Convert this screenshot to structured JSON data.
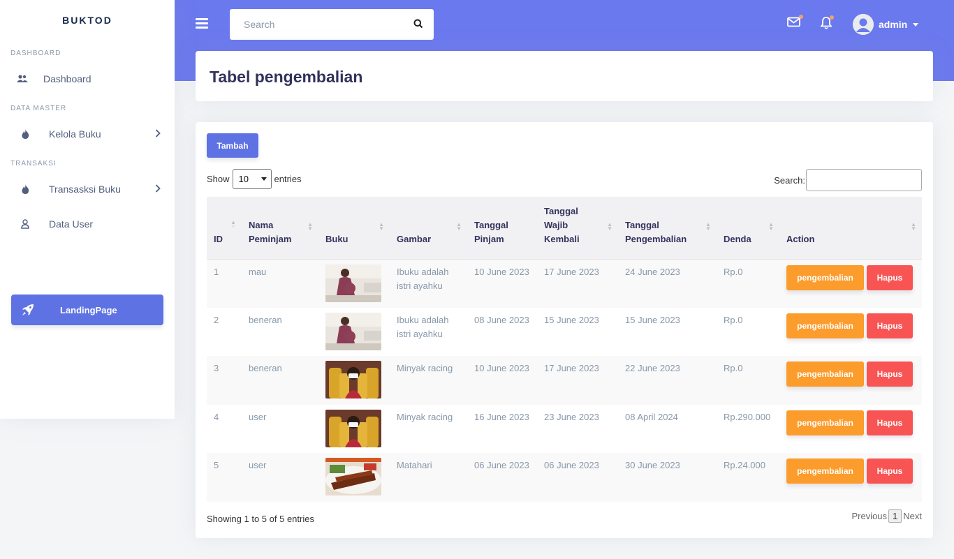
{
  "sidebar": {
    "brand": "BUKTOD",
    "sections": [
      {
        "heading": "DASHBOARD",
        "items": [
          {
            "label": "Dashboard",
            "icon": "users-icon"
          }
        ]
      },
      {
        "heading": "DATA MASTER",
        "items": [
          {
            "label": "Kelola Buku",
            "icon": "fire-icon"
          }
        ]
      },
      {
        "heading": "TRANSAKSI",
        "items": [
          {
            "label": "Transasksi Buku",
            "icon": "fire-icon"
          },
          {
            "label": "Data User",
            "icon": "user-icon"
          }
        ]
      }
    ],
    "landing_label": "LandingPage"
  },
  "header": {
    "search_placeholder": "Search",
    "user_name": "admin"
  },
  "page": {
    "title": "Tabel pengembalian"
  },
  "table_controls": {
    "add_label": "Tambah",
    "show_label": "Show",
    "entries_value": "10",
    "entries_label": "entries",
    "search_label": "Search:"
  },
  "table": {
    "headers": [
      "ID",
      "Nama Peminjam",
      "Buku",
      "Gambar",
      "Tanggal Pinjam",
      "Tanggal Wajib Kembali",
      "Tanggal Pengembalian",
      "Denda",
      "Action"
    ],
    "rows": [
      {
        "id": "1",
        "nama": "mau",
        "gambar": "Ibuku adalah istri ayahku",
        "pinjam": "10 June 2023",
        "wajib": "17 June 2023",
        "kembali": "24 June 2023",
        "denda": "Rp.0",
        "img": "pregnant"
      },
      {
        "id": "2",
        "nama": "beneran",
        "gambar": "Ibuku adalah istri ayahku",
        "pinjam": "08 June 2023",
        "wajib": "15 June 2023",
        "kembali": "15 June 2023",
        "denda": "Rp.0",
        "img": "pregnant"
      },
      {
        "id": "3",
        "nama": "beneran",
        "gambar": "Minyak racing",
        "pinjam": "10 June 2023",
        "wajib": "17 June 2023",
        "kembali": "22 June 2023",
        "denda": "Rp.0",
        "img": "oil"
      },
      {
        "id": "4",
        "nama": "user",
        "gambar": "Minyak racing",
        "pinjam": "16 June 2023",
        "wajib": "23 June 2023",
        "kembali": "08 April 2024",
        "denda": "Rp.290.000",
        "img": "oil"
      },
      {
        "id": "5",
        "nama": "user",
        "gambar": "Matahari",
        "pinjam": "06 June 2023",
        "wajib": "06 June 2023",
        "kembali": "30 June 2023",
        "denda": "Rp.24.000",
        "img": "satay"
      }
    ],
    "return_label": "pengembalian",
    "delete_label": "Hapus"
  },
  "footer": {
    "info_prefix": "Showing ",
    "info_from": "1",
    "info_to_word": " to ",
    "info_to": "5",
    "info_of_word": " of ",
    "info_total": "5",
    "info_suffix": " entries",
    "prev_label": "Previous",
    "page": "1",
    "next_label": "Next"
  },
  "colors": {
    "primary": "#5e72e4",
    "header_bg": "#6b79ee",
    "warning": "#fb9c2c",
    "danger": "#f85454"
  }
}
